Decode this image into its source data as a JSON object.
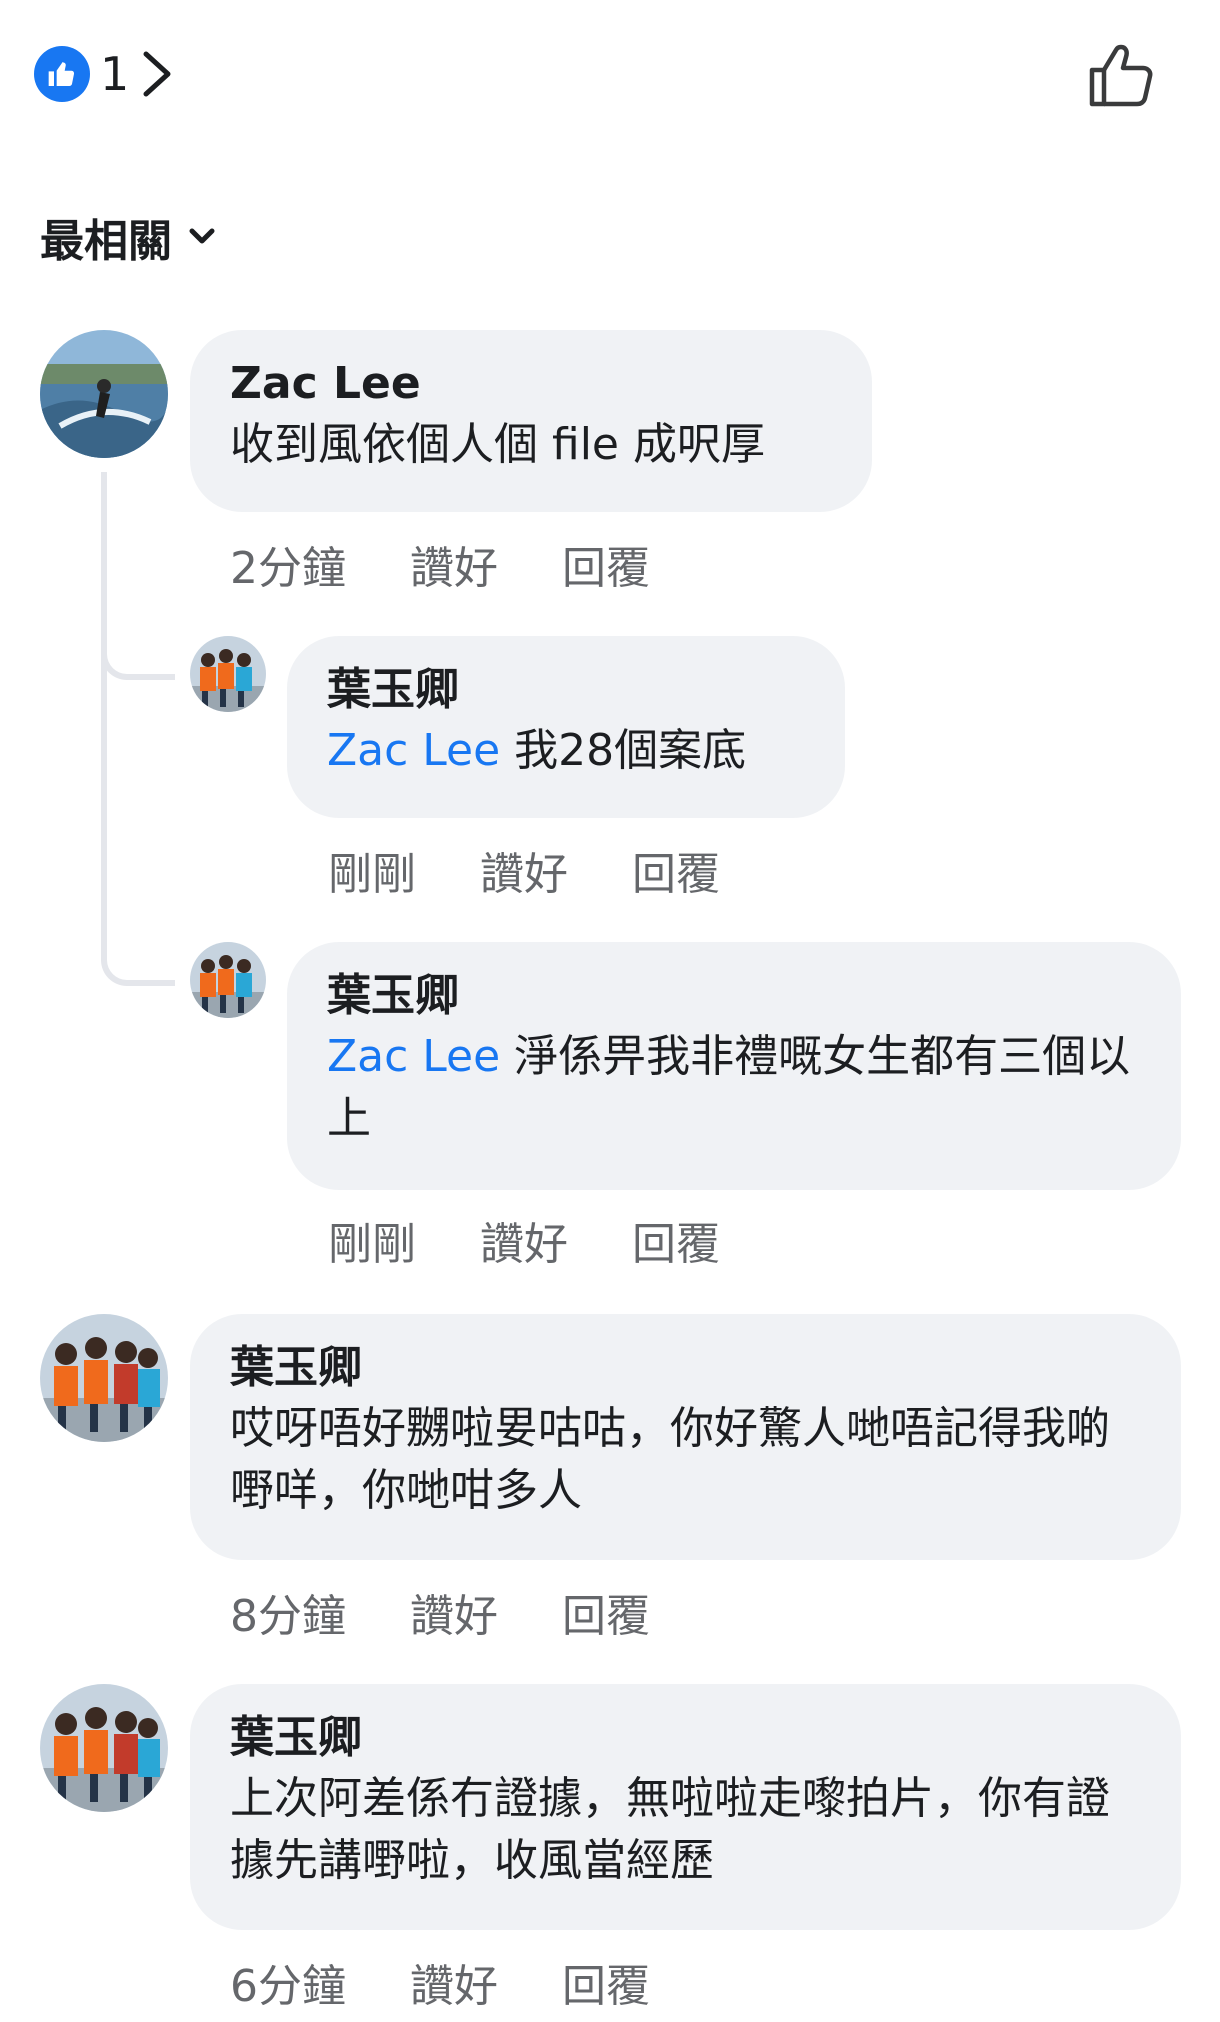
{
  "reactions": {
    "icon": "thumbs-up-icon",
    "count": "1"
  },
  "sort": {
    "label": "最相關"
  },
  "comments": [
    {
      "author": "Zac Lee",
      "text": "收到風依個人個 file 成呎厚",
      "time": "2分鐘",
      "like": "讚好",
      "reply": "回覆",
      "replies": [
        {
          "author": "葉玉卿",
          "mention": "Zac Lee",
          "text": " 我28個案底",
          "time": "剛剛",
          "like": "讚好",
          "reply": "回覆"
        },
        {
          "author": "葉玉卿",
          "mention": "Zac Lee",
          "text": " 淨係畀我非禮嘅女生都有三個以上",
          "time": "剛剛",
          "like": "讚好",
          "reply": "回覆"
        }
      ]
    },
    {
      "author": "葉玉卿",
      "text": "哎呀唔好嬲啦㚻咕咕，你好驚人哋唔記得我啲嘢咩，你哋咁多人",
      "time": "8分鐘",
      "like": "讚好",
      "reply": "回覆"
    },
    {
      "author": "葉玉卿",
      "text": "上次阿差係冇證據，無啦啦走嚟拍片，你有證據先講嘢啦，收風當經歷",
      "time": "6分鐘",
      "like": "讚好",
      "reply": "回覆"
    }
  ],
  "colors": {
    "accent": "#1877f2",
    "bubble": "#f0f2f5",
    "meta": "#65676b"
  }
}
